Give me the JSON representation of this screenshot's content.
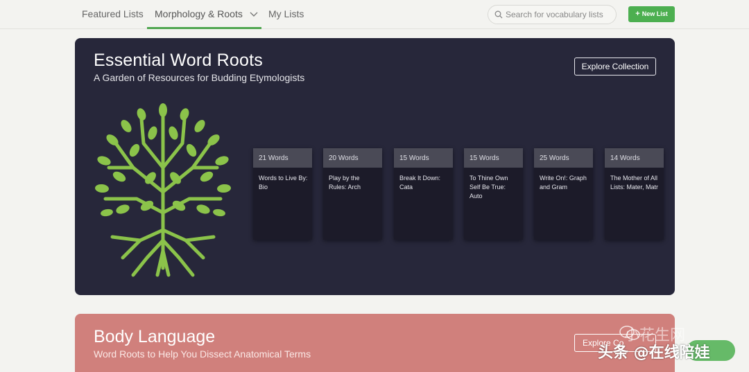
{
  "nav": {
    "tabs": [
      {
        "label": "Featured Lists"
      },
      {
        "label": "Morphology & Roots"
      },
      {
        "label": "My Lists"
      }
    ],
    "search_placeholder": "Search for vocabulary lists",
    "new_list_label": "New List"
  },
  "collection": {
    "title": "Essential Word Roots",
    "subtitle": "A Garden of Resources for Budding Etymologists",
    "explore_label": "Explore Collection",
    "cards": [
      {
        "count": "21 Words",
        "title": "Words to Live By: Bio"
      },
      {
        "count": "20 Words",
        "title": "Play by the Rules: Arch"
      },
      {
        "count": "15 Words",
        "title": "Break It Down: Cata"
      },
      {
        "count": "15 Words",
        "title": "To Thine Own Self Be True: Auto"
      },
      {
        "count": "25 Words",
        "title": "Write On!: Graph and Gram"
      },
      {
        "count": "14 Words",
        "title": "The Mother of All Lists: Mater, Matr"
      }
    ]
  },
  "collection2": {
    "title": "Body Language",
    "subtitle": "Word Roots to Help You Dissect Anatomical Terms",
    "explore_label": "Explore Co"
  },
  "watermark": {
    "top_text": "小花生网",
    "bottom_text": "头条 @在线陪娃"
  },
  "colors": {
    "accent_green": "#4caf50",
    "dark_panel": "#27273a",
    "pink_panel": "#d0807c",
    "tree_green": "#8bc34a"
  },
  "icons": {
    "search": "search-icon",
    "chevron": "chevron-down-icon",
    "plus": "plus-icon",
    "tree": "tree-logo"
  }
}
